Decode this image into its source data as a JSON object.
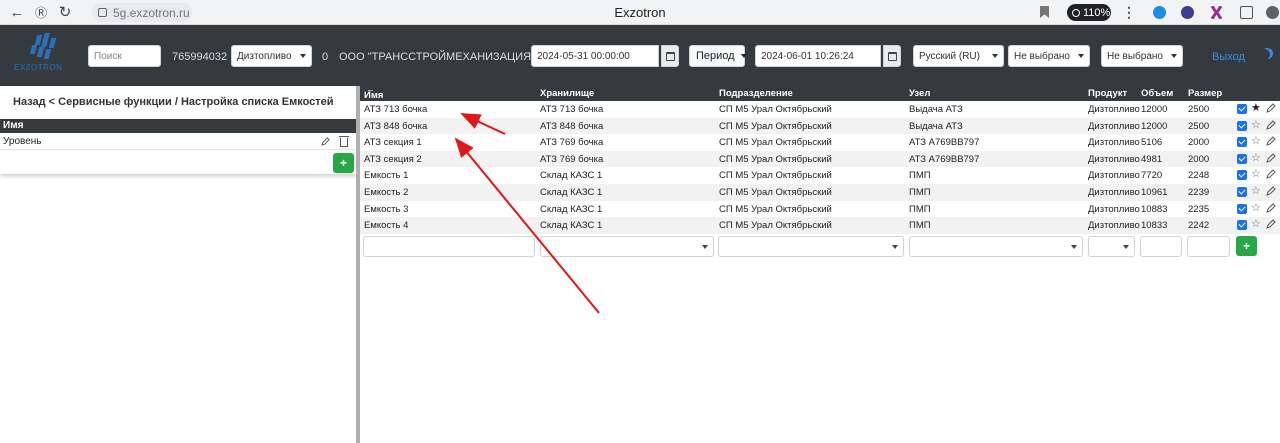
{
  "browser": {
    "url": "5g.exzotron.ru",
    "tab_title": "Exzotron",
    "zoom": "110%"
  },
  "header": {
    "brand": "EXZOTRON",
    "search_placeholder": "Поиск",
    "account_id": "765994032",
    "fuel_select": "Дизтопливо",
    "count": "0",
    "company": "ООО \"ТРАНССТРОЙМЕХАНИЗАЦИЯ\"",
    "date_from": "2024-05-31 00:00:00",
    "period_label": "Период",
    "date_to": "2024-06-01 10:26:24",
    "language": "Русский (RU)",
    "filter1": "Не выбрано",
    "filter2": "Не выбрано",
    "logout": "Выход",
    "accent": "#3d8be0"
  },
  "left": {
    "breadcrumb": "Назад < Сервисные функции / Настройка списка Емкостей",
    "col_name": "Имя",
    "rows": [
      {
        "name": "Уровень"
      }
    ]
  },
  "table": {
    "headers": {
      "name": "Имя",
      "storage": "Хранилище",
      "division": "Подразделение",
      "node": "Узел",
      "product": "Продукт",
      "volume": "Объем",
      "size": "Размер"
    },
    "rows": [
      {
        "name": "АТЗ 713 бочка",
        "storage": "АТЗ 713 бочка",
        "division": "СП М5 Урал Октябрьский",
        "node": "Выдача АТЗ",
        "product": "Дизтопливо",
        "volume": "12000",
        "size": "2500",
        "checked": true,
        "starred": true
      },
      {
        "name": "АТЗ 848 бочка",
        "storage": "АТЗ 848 бочка",
        "division": "СП М5 Урал Октябрьский",
        "node": "Выдача АТЗ",
        "product": "Дизтопливо",
        "volume": "12000",
        "size": "2500",
        "checked": true,
        "starred": false
      },
      {
        "name": "АТЗ секция 1",
        "storage": "АТЗ 769 бочка",
        "division": "СП М5 Урал Октябрьский",
        "node": "АТЗ А769ВВ797",
        "product": "Дизтопливо",
        "volume": "5106",
        "size": "2000",
        "checked": true,
        "starred": false
      },
      {
        "name": "АТЗ секция 2",
        "storage": "АТЗ 769 бочка",
        "division": "СП М5 Урал Октябрьский",
        "node": "АТЗ А769ВВ797",
        "product": "Дизтопливо",
        "volume": "4981",
        "size": "2000",
        "checked": true,
        "starred": false
      },
      {
        "name": "Емкость 1",
        "storage": "Склад КАЗС 1",
        "division": "СП М5 Урал Октябрьский",
        "node": "ПМП",
        "product": "Дизтопливо",
        "volume": "7720",
        "size": "2248",
        "checked": true,
        "starred": false
      },
      {
        "name": "Емкость 2",
        "storage": "Склад КАЗС 1",
        "division": "СП М5 Урал Октябрьский",
        "node": "ПМП",
        "product": "Дизтопливо",
        "volume": "10961",
        "size": "2239",
        "checked": true,
        "starred": false
      },
      {
        "name": "Емкость 3",
        "storage": "Склад КАЗС 1",
        "division": "СП М5 Урал Октябрьский",
        "node": "ПМП",
        "product": "Дизтопливо",
        "volume": "10883",
        "size": "2235",
        "checked": true,
        "starred": false
      },
      {
        "name": "Емкость 4",
        "storage": "Склад КАЗС 1",
        "division": "СП М5 Урал Октябрьский",
        "node": "ПМП",
        "product": "Дизтопливо",
        "volume": "10833",
        "size": "2242",
        "checked": true,
        "starred": false
      }
    ],
    "add_label": "+"
  },
  "colors": {
    "header_bg": "#343a40",
    "checkbox": "#1a73e8",
    "add_button": "#28a745",
    "annotation": "#e01818"
  }
}
